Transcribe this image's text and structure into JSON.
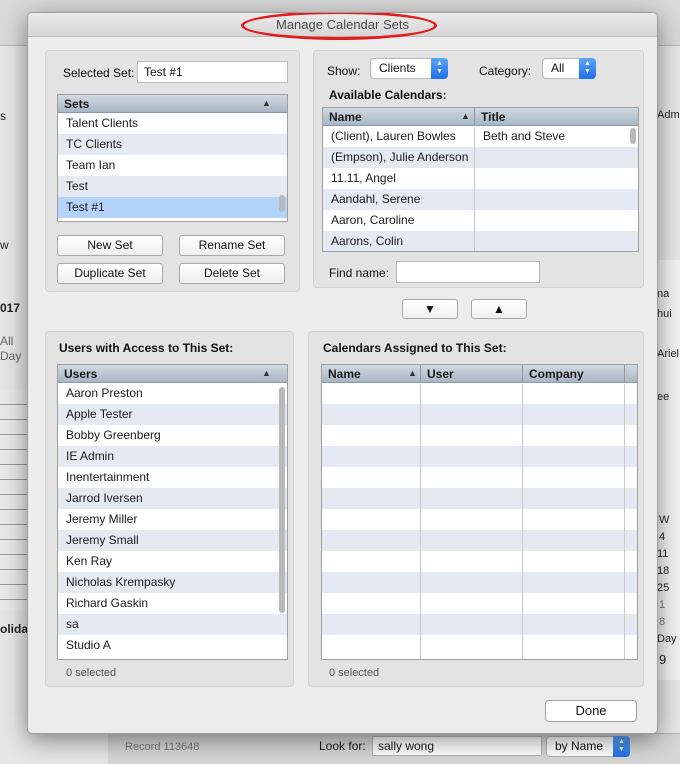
{
  "dialog": {
    "title": "Manage Calendar Sets",
    "selected_set_label": "Selected Set:",
    "selected_set_value": "Test #1",
    "show_label": "Show:",
    "show_value": "Clients",
    "category_label": "Category:",
    "category_value": "All",
    "available_label": "Available Calendars:",
    "find_name_label": "Find name:",
    "find_name_value": "",
    "users_access_label": "Users with Access to This Set:",
    "assigned_label": "Calendars Assigned to This Set:",
    "users_status": "0 selected",
    "assigned_status": "0 selected",
    "done_label": "Done",
    "move_down_symbol": "▼",
    "move_up_symbol": "▲"
  },
  "sets": {
    "header": "Sets",
    "items": [
      "Talent Clients",
      "TC Clients",
      "Team Ian",
      "Test",
      "Test #1"
    ],
    "selected_index": 4
  },
  "set_buttons": {
    "new": "New Set",
    "rename": "Rename Set",
    "duplicate": "Duplicate Set",
    "delete": "Delete Set"
  },
  "available": {
    "columns": [
      "Name",
      "Title"
    ],
    "rows": [
      {
        "name": "(Client), Lauren Bowles",
        "title": "Beth and Steve"
      },
      {
        "name": "(Empson), Julie Anderson",
        "title": ""
      },
      {
        "name": "11.11, Angel",
        "title": ""
      },
      {
        "name": "Aandahl, Serene",
        "title": ""
      },
      {
        "name": "Aaron, Caroline",
        "title": ""
      },
      {
        "name": "Aarons, Colin",
        "title": ""
      }
    ]
  },
  "users": {
    "header": "Users",
    "items": [
      "Aaron Preston",
      "Apple Tester",
      "Bobby Greenberg",
      "IE Admin",
      "Inentertainment",
      "Jarrod Iversen",
      "Jeremy Miller",
      "Jeremy Small",
      "Ken Ray",
      "Nicholas Krempasky",
      "Richard Gaskin",
      "sa",
      "Studio A"
    ]
  },
  "assigned": {
    "columns": [
      "Name",
      "User",
      "Company"
    ]
  },
  "background": {
    "left_texts": [
      "s",
      "w",
      "017",
      "All",
      "Day",
      "oliday"
    ],
    "right_texts": [
      "na",
      "hui",
      "Ariel",
      "ee",
      "W",
      "4",
      "11",
      "18",
      "25",
      "1",
      "8",
      "Day",
      "9"
    ],
    "top_right_text": "Adm",
    "record_text": "Record 113648",
    "look_for_label": "Look for:",
    "look_for_value": "sally wong",
    "sort_popup": "by Name"
  }
}
